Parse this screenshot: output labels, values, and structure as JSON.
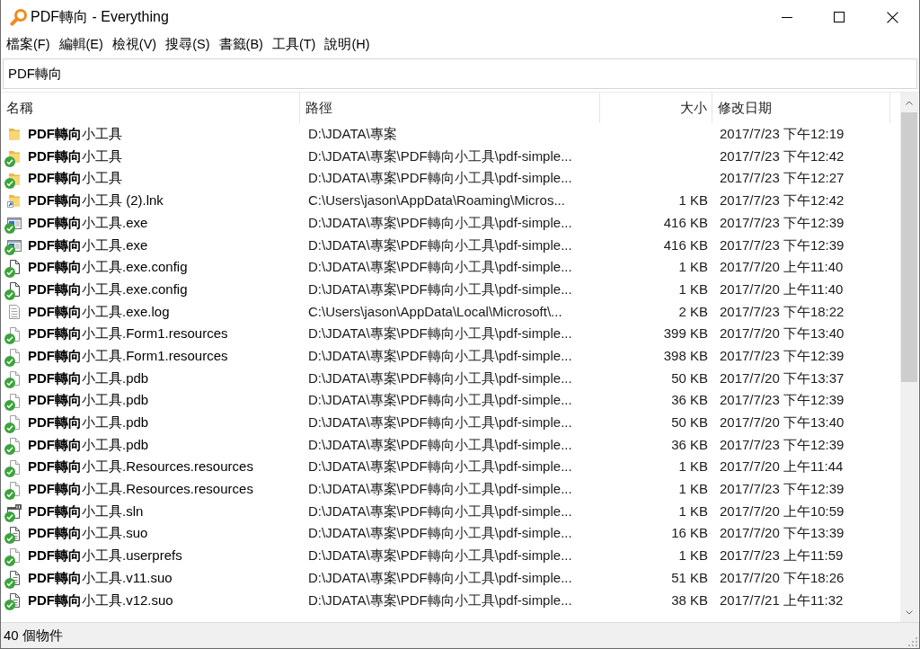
{
  "window": {
    "title": "PDF轉向 - Everything"
  },
  "menu_bar": {
    "items": [
      "檔案(F)",
      "編輯(E)",
      "檢視(V)",
      "搜尋(S)",
      "書籤(B)",
      "工具(T)",
      "說明(H)"
    ]
  },
  "search": {
    "value": "PDF轉向"
  },
  "table": {
    "columns": [
      "名稱",
      "路徑",
      "大小",
      "修改日期"
    ],
    "rows": [
      {
        "kind": "folder",
        "synced": false,
        "name": "**PDF轉向**小工具",
        "path": "D:\\JDATA\\專案",
        "date": "2017/7/23 下午12:19"
      },
      {
        "kind": "folder",
        "synced": true,
        "name": "**PDF轉向**小工具",
        "path": "D:\\JDATA\\專案\\PDF轉向小工具\\pdf-simple...",
        "date": "2017/7/23 下午12:42"
      },
      {
        "kind": "folder",
        "synced": true,
        "name": "**PDF轉向**小工具",
        "path": "D:\\JDATA\\專案\\PDF轉向小工具\\pdf-simple...",
        "date": "2017/7/23 下午12:27"
      },
      {
        "kind": "shortcut",
        "synced": false,
        "name": "**PDF轉向**小工具 (2).lnk",
        "path": "C:\\Users\\jason\\AppData\\Roaming\\Micros...",
        "size": "1 KB",
        "date": "2017/7/23 下午12:42"
      },
      {
        "kind": "exe",
        "synced": true,
        "name": "**PDF轉向**小工具.exe",
        "path": "D:\\JDATA\\專案\\PDF轉向小工具\\pdf-simple...",
        "size": "416 KB",
        "date": "2017/7/23 下午12:39"
      },
      {
        "kind": "exe",
        "synced": true,
        "name": "**PDF轉向**小工具.exe",
        "path": "D:\\JDATA\\專案\\PDF轉向小工具\\pdf-simple...",
        "size": "416 KB",
        "date": "2017/7/23 下午12:39"
      },
      {
        "kind": "config",
        "synced": true,
        "name": "**PDF轉向**小工具.exe.config",
        "path": "D:\\JDATA\\專案\\PDF轉向小工具\\pdf-simple...",
        "size": "1 KB",
        "date": "2017/7/20 上午11:40"
      },
      {
        "kind": "config",
        "synced": true,
        "name": "**PDF轉向**小工具.exe.config",
        "path": "D:\\JDATA\\專案\\PDF轉向小工具\\pdf-simple...",
        "size": "1 KB",
        "date": "2017/7/20 上午11:40"
      },
      {
        "kind": "text",
        "synced": false,
        "name": "**PDF轉向**小工具.exe.log",
        "path": "C:\\Users\\jason\\AppData\\Local\\Microsoft\\...",
        "size": "2 KB",
        "date": "2017/7/23 下午18:22"
      },
      {
        "kind": "file",
        "synced": true,
        "name": "**PDF轉向**小工具.Form1.resources",
        "path": "D:\\JDATA\\專案\\PDF轉向小工具\\pdf-simple...",
        "size": "399 KB",
        "date": "2017/7/20 下午13:40"
      },
      {
        "kind": "file",
        "synced": true,
        "name": "**PDF轉向**小工具.Form1.resources",
        "path": "D:\\JDATA\\專案\\PDF轉向小工具\\pdf-simple...",
        "size": "398 KB",
        "date": "2017/7/23 下午12:39"
      },
      {
        "kind": "file",
        "synced": true,
        "name": "**PDF轉向**小工具.pdb",
        "path": "D:\\JDATA\\專案\\PDF轉向小工具\\pdf-simple...",
        "size": "50 KB",
        "date": "2017/7/20 下午13:37"
      },
      {
        "kind": "file",
        "synced": true,
        "name": "**PDF轉向**小工具.pdb",
        "path": "D:\\JDATA\\專案\\PDF轉向小工具\\pdf-simple...",
        "size": "36 KB",
        "date": "2017/7/23 下午12:39"
      },
      {
        "kind": "file",
        "synced": true,
        "name": "**PDF轉向**小工具.pdb",
        "path": "D:\\JDATA\\專案\\PDF轉向小工具\\pdf-simple...",
        "size": "50 KB",
        "date": "2017/7/20 下午13:40"
      },
      {
        "kind": "file",
        "synced": true,
        "name": "**PDF轉向**小工具.pdb",
        "path": "D:\\JDATA\\專案\\PDF轉向小工具\\pdf-simple...",
        "size": "36 KB",
        "date": "2017/7/23 下午12:39"
      },
      {
        "kind": "file",
        "synced": true,
        "name": "**PDF轉向**小工具.Resources.resources",
        "path": "D:\\JDATA\\專案\\PDF轉向小工具\\pdf-simple...",
        "size": "1 KB",
        "date": "2017/7/20 上午11:44"
      },
      {
        "kind": "file",
        "synced": true,
        "name": "**PDF轉向**小工具.Resources.resources",
        "path": "D:\\JDATA\\專案\\PDF轉向小工具\\pdf-simple...",
        "size": "1 KB",
        "date": "2017/7/23 下午12:39"
      },
      {
        "kind": "solution",
        "synced": true,
        "name": "**PDF轉向**小工具.sln",
        "path": "D:\\JDATA\\專案\\PDF轉向小工具\\pdf-simple...",
        "size": "1 KB",
        "date": "2017/7/20 上午10:59"
      },
      {
        "kind": "document",
        "synced": true,
        "name": "**PDF轉向**小工具.suo",
        "path": "D:\\JDATA\\專案\\PDF轉向小工具\\pdf-simple...",
        "size": "16 KB",
        "date": "2017/7/20 下午13:39"
      },
      {
        "kind": "file",
        "synced": true,
        "name": "**PDF轉向**小工具.userprefs",
        "path": "D:\\JDATA\\專案\\PDF轉向小工具\\pdf-simple...",
        "size": "1 KB",
        "date": "2017/7/23 上午11:59"
      },
      {
        "kind": "document",
        "synced": true,
        "name": "**PDF轉向**小工具.v11.suo",
        "path": "D:\\JDATA\\專案\\PDF轉向小工具\\pdf-simple...",
        "size": "51 KB",
        "date": "2017/7/20 下午18:26"
      },
      {
        "kind": "document",
        "synced": true,
        "name": "**PDF轉向**小工具.v12.suo",
        "path": "D:\\JDATA\\專案\\PDF轉向小工具\\pdf-simple...",
        "size": "38 KB",
        "date": "2017/7/21 上午11:32"
      }
    ]
  },
  "status_bar": {
    "text": "40 個物件"
  }
}
